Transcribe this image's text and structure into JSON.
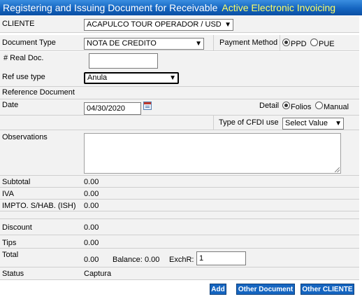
{
  "header": {
    "title": "Registering and Issuing Document for Receivable",
    "accent": "Active Electronic Invoicing"
  },
  "cliente": {
    "label": "CLIENTE",
    "value": "ACAPULCO TOUR OPERADOR / USD"
  },
  "document_type": {
    "label": "Document Type",
    "value": "NOTA DE CREDITO"
  },
  "payment_method": {
    "label": "Payment Method",
    "options": [
      "PPD",
      "PUE"
    ],
    "selected": "PPD"
  },
  "real_doc": {
    "label": "# Real Doc.",
    "value": ""
  },
  "ref_use_type": {
    "label": "Ref use type",
    "value": "Anula"
  },
  "reference_document": {
    "label": "Reference Document"
  },
  "date": {
    "label": "Date",
    "value": "04/30/2020"
  },
  "detail": {
    "label": "Detail",
    "options": [
      "Folios",
      "Manual"
    ],
    "selected": "Folios"
  },
  "cfdi": {
    "label": "Type of CFDI use",
    "value": "Select Value"
  },
  "observations": {
    "label": "Observations",
    "value": ""
  },
  "totals": {
    "subtotal_label": "Subtotal",
    "subtotal": "0.00",
    "iva_label": "IVA",
    "iva": "0.00",
    "ish_label": "IMPTO. S/HAB. (ISH)",
    "ish": "0.00",
    "discount_label": "Discount",
    "discount": "0.00",
    "tips_label": "Tips",
    "tips": "0.00",
    "total_label": "Total",
    "total": "0.00",
    "balance_label": "Balance:",
    "balance": "0.00",
    "exchr_label": "ExchR:",
    "exchr": "1"
  },
  "status": {
    "label": "Status",
    "value": "Captura"
  },
  "buttons": {
    "add": "Add",
    "other_document": "Other Document",
    "other_cliente": "Other CLIENTE"
  },
  "colors": {
    "title_bg": "#1565c0",
    "title_accent": "#ffff66",
    "row_bg": "#f2f2f2",
    "button_bg": "#1565c0"
  }
}
